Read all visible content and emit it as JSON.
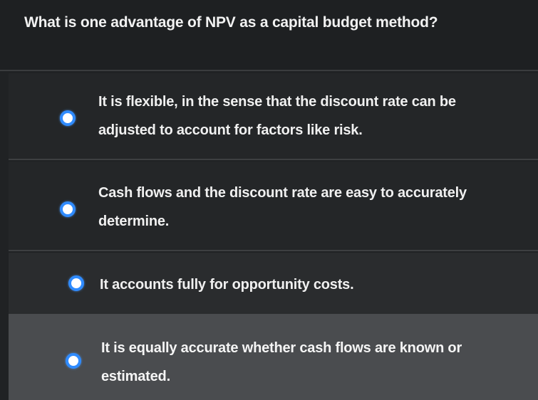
{
  "question": {
    "text": "What is one advantage of NPV as a capital budget method?"
  },
  "options": [
    {
      "line1": "It is flexible, in the sense that the discount rate can be",
      "line2": "adjusted to account for factors like risk.",
      "selected": false
    },
    {
      "line1": "Cash flows and the discount rate are easy to accurately",
      "line2": "determine.",
      "selected": false
    },
    {
      "line1": "It accounts fully for opportunity costs.",
      "selected": false
    },
    {
      "line1": "It is equally accurate whether cash flows are known or",
      "line2": "estimated.",
      "selected": false
    }
  ],
  "colors": {
    "radio_border": "#2f8bff",
    "background": "#202224",
    "highlight_row": "#4a4c4f"
  }
}
